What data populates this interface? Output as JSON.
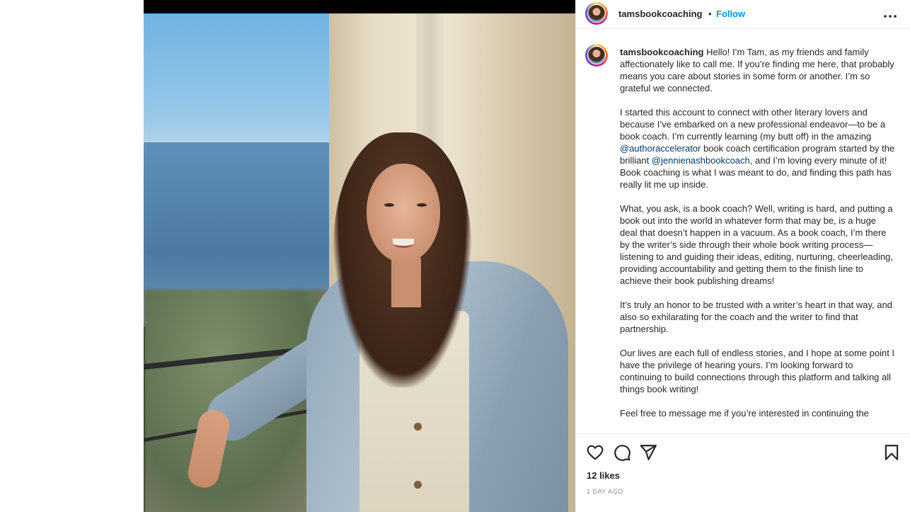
{
  "post": {
    "username": "tamsbookcoaching",
    "separator": "•",
    "follow_label": "Follow",
    "more_label": "•••",
    "caption_username": "tamsbookcoaching",
    "caption": {
      "p1": "Hello! I’m Tam, as my friends and family affectionately like to call me. If you’re finding me here, that probably means you care about stories in some form or another. I’m so grateful we connected.",
      "p2_a": "I started this account to connect with other literary lovers and because I’ve embarked on a new professional endeavor—to be a book coach. I’m currently learning (my butt off) in the amazing ",
      "p2_mention1": "@authoraccelerator",
      "p2_b": " book coach certification program started by the brilliant ",
      "p2_mention2": "@jennienashbookcoach",
      "p2_c": ", and I’m loving every minute of it! Book coaching is what I was meant to do, and finding this path has really lit me up inside.",
      "p3": "What, you ask, is a book coach? Well, writing is hard, and putting a book out into the world in whatever form that may be, is a huge deal that doesn’t happen in a vacuum. As a book coach, I’m there by the writer’s side through their whole book writing process—listening to and guiding their ideas, editing, nurturing, cheerleading, providing accountability and getting them to the finish line to achieve their book publishing dreams!",
      "p4": "It’s truly an honor to be trusted with a writer’s heart in that way, and also so exhilarating for the coach and the writer to find that partnership.",
      "p5": "Our lives are each full of endless stories, and I hope at some point I have the privilege of hearing yours. I’m looking forward to continuing to build connections through this platform and talking all things book writing!",
      "p6": "Feel free to message me if you’re interested in continuing the"
    },
    "likes": "12 likes",
    "time": "1 DAY AGO"
  },
  "icons": {
    "like": "heart-icon",
    "comment": "comment-icon",
    "share": "paper-plane-icon",
    "save": "bookmark-icon"
  },
  "colors": {
    "follow": "#0095f6",
    "mention": "#00376b",
    "timestamp": "#8e8e8e"
  }
}
